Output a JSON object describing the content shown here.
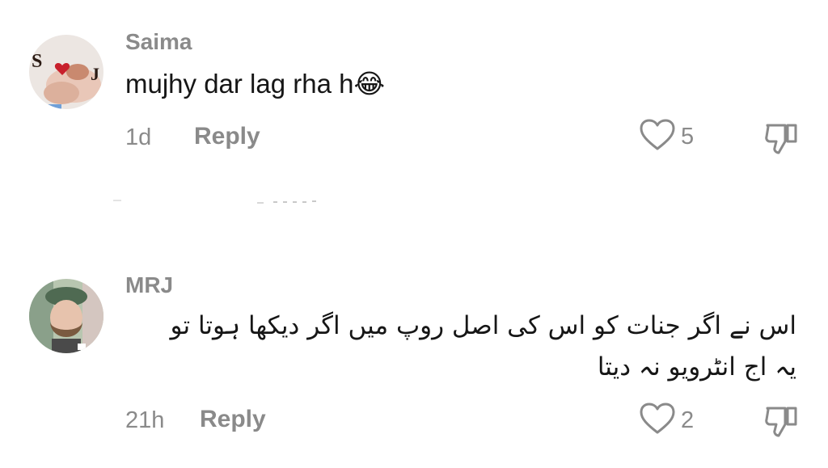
{
  "comments": [
    {
      "username": "Saima",
      "text": "mujhy dar lag rha h",
      "emoji": "😂",
      "time": "1d",
      "reply_label": "Reply",
      "likes": "5",
      "avatar_letters": [
        "S",
        "J"
      ],
      "icons": {
        "like": "heart-outline-icon",
        "dislike": "thumbs-down-icon"
      }
    },
    {
      "username": "MRJ",
      "text_line1": "اس نے اگر جنات کو اس کی اصل روپ میں اگر دیکھا ہوتا تو",
      "text_line2": "یہ اج انٹرویو نہ دیتا",
      "time": "21h",
      "reply_label": "Reply",
      "likes": "2",
      "icons": {
        "like": "heart-outline-icon",
        "dislike": "thumbs-down-icon"
      }
    }
  ],
  "colors": {
    "text": "#161616",
    "muted": "#8a8a8a",
    "background": "#ffffff"
  }
}
